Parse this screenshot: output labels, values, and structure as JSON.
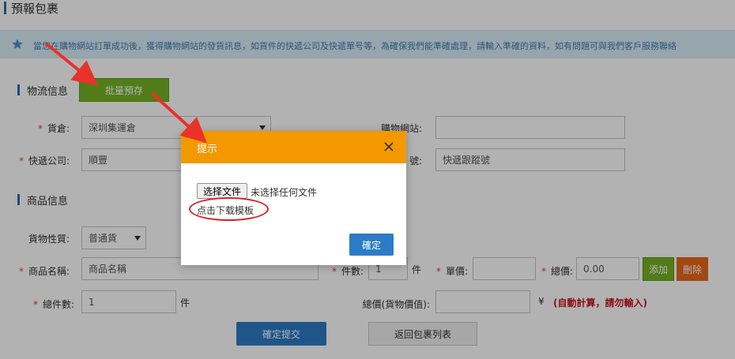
{
  "page": {
    "title": "預報包裹"
  },
  "notice": {
    "text": "當您在購物網站訂單成功後，獲得購物網站的發貨訊息，如貨件的快遞公司及快遞單号等，為確保我們能準確處理，請輸入準確的資料，如有問題可與我們客戶服務聯絡"
  },
  "logistics": {
    "section_title": "物流信息",
    "batch_button": "批量預存",
    "warehouse_label": "貨倉:",
    "warehouse_value": "深圳集運倉",
    "shop_site_label": "購物網站:",
    "courier_label": "快遞公司:",
    "courier_value": "順豐",
    "tracking_label": "號:",
    "tracking_placeholder": "快遞跟蹤號"
  },
  "goods": {
    "section_title": "商品信息",
    "type_label": "貨物性質:",
    "type_value": "普通貨",
    "name_label": "商品名稱:",
    "name_placeholder": "商品名稱",
    "qty_label": "件數:",
    "qty_value": "1",
    "qty_unit": "件",
    "price_label": "單價:",
    "total_label": "總價:",
    "total_value": "0.00",
    "add_button": "添加",
    "delete_button": "刪除",
    "total_qty_label": "總件數:",
    "total_qty_value": "1",
    "total_qty_unit": "件",
    "goods_value_label": "總價(貨物價值):",
    "currency": "¥",
    "auto_calc_hint": "(自動計算，請勿輸入)"
  },
  "actions": {
    "submit_button": "確定提交",
    "back_button": "返回包裹列表"
  },
  "modal": {
    "title": "提示",
    "file_button": "选择文件",
    "file_status": "未选择任何文件",
    "download_link": "点击下载模板",
    "ok_button": "確定"
  },
  "colors": {
    "modal_header": "#f39800",
    "primary_blue": "#2c7bc6",
    "green_button": "#74b324",
    "orange_button": "#e8671a",
    "hint_red": "#c8161d",
    "annotation_red": "#d8232a"
  }
}
